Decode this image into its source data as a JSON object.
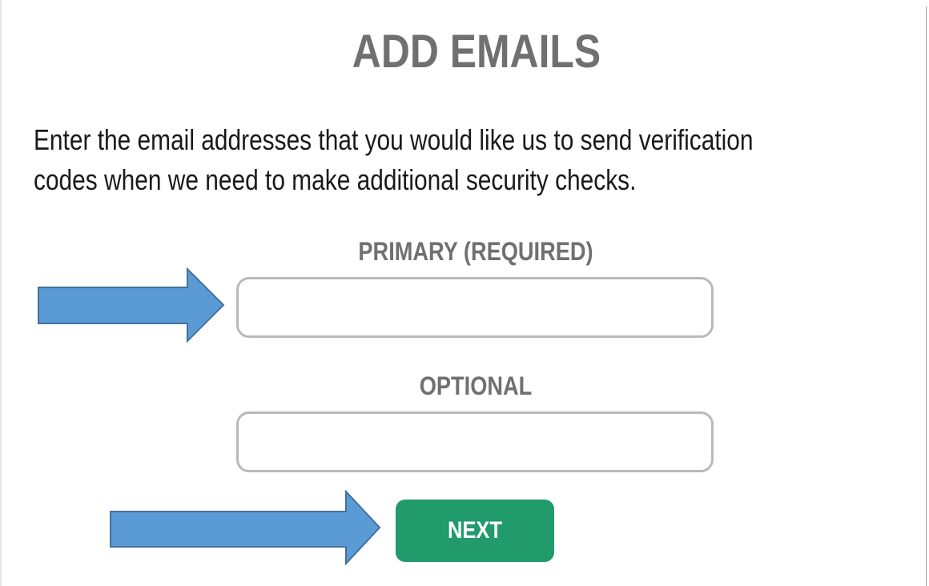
{
  "page": {
    "title": "ADD EMAILS",
    "instructions": [
      "Enter the email addresses that you would like us to send verification",
      "codes when we need to make additional security checks."
    ]
  },
  "form": {
    "primary": {
      "label": "PRIMARY (REQUIRED)",
      "value": "",
      "placeholder": ""
    },
    "optional": {
      "label": "OPTIONAL",
      "value": "",
      "placeholder": ""
    },
    "next_label": "NEXT"
  },
  "annotations": {
    "arrow_color": "#5b9bd5",
    "arrow_stroke": "#41719c",
    "arrows": [
      "arrow-right-icon",
      "arrow-right-icon"
    ]
  },
  "colors": {
    "title": "#707070",
    "button": "#219a6c",
    "field_border": "#b9b9b9"
  }
}
